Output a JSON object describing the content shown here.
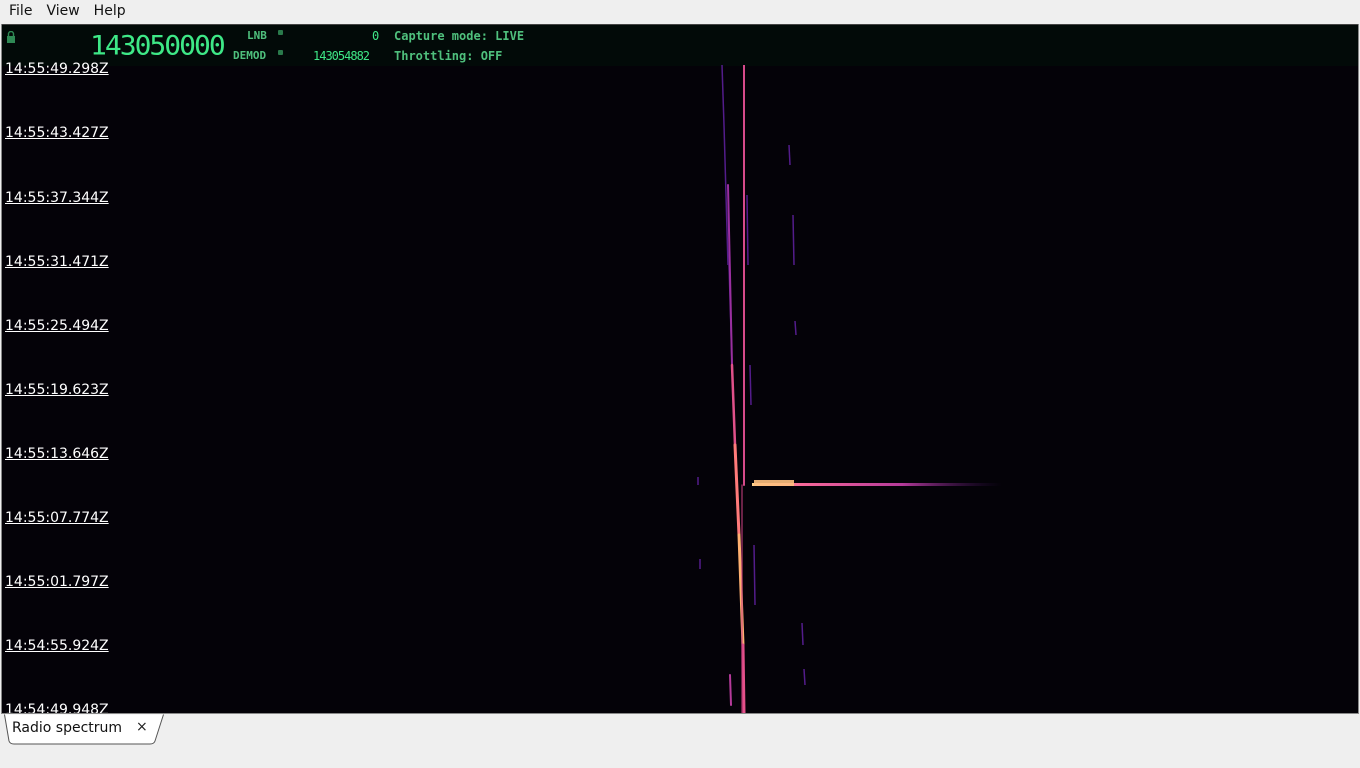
{
  "menu": [
    "File",
    "View",
    "Help"
  ],
  "status": {
    "big_frequency": "143050000",
    "lnb_label": "LNB",
    "lnb_value": "0",
    "demod_label": "DEMOD",
    "demod_value": "143054882",
    "capture_mode": "Capture mode: LIVE",
    "throttling": "Throttling: OFF",
    "accent_color": "#3ee887"
  },
  "timestamps": [
    "14:55:49.298Z",
    "14:55:43.427Z",
    "14:55:37.344Z",
    "14:55:31.471Z",
    "14:55:25.494Z",
    "14:55:19.623Z",
    "14:55:13.646Z",
    "14:55:07.774Z",
    "14:55:01.797Z",
    "14:54:55.924Z",
    "14:54:49.948Z"
  ],
  "tab": {
    "label": "Radio spectrum",
    "close": "×"
  }
}
